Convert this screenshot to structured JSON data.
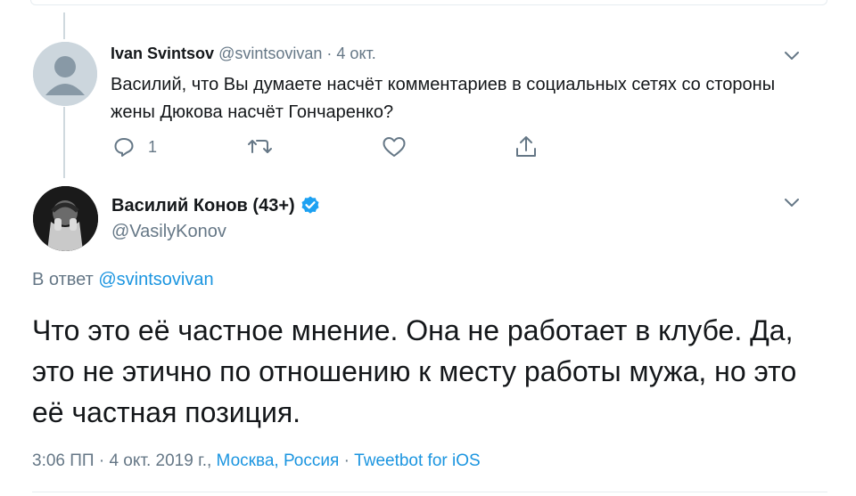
{
  "reply_tweet": {
    "display_name": "Ivan Svintsov",
    "handle": "@svintsovivan",
    "date": "4 окт.",
    "separator": "·",
    "text": "Василий, что Вы думаете насчёт комментариев в социальных сетях со стороны жены Дюкова насчёт Гончаренко?",
    "reply_count": "1",
    "icons": [
      "reply-icon",
      "retweet-icon",
      "like-icon",
      "share-icon",
      "chevron-down-icon"
    ]
  },
  "main_tweet": {
    "display_name": "Василий Конов (43+)",
    "handle": "@VasilyKonov",
    "in_reply_prefix": "В ответ",
    "in_reply_handle": "@svintsovivan",
    "text": "Что это её частное мнение. Она не работает в клубе. Да, это не этично по отношению к месту работы мужа, но это её частная позиция.",
    "time": "3:06 ПП · 4 окт. 2019 г.,",
    "location": "Москва, Россия",
    "source_separator": "·",
    "source": "Tweetbot for iOS"
  },
  "colors": {
    "link": "#1b95e0",
    "secondary_text": "#657786",
    "verified": "#1da1f2",
    "border": "#e6ecf0"
  }
}
